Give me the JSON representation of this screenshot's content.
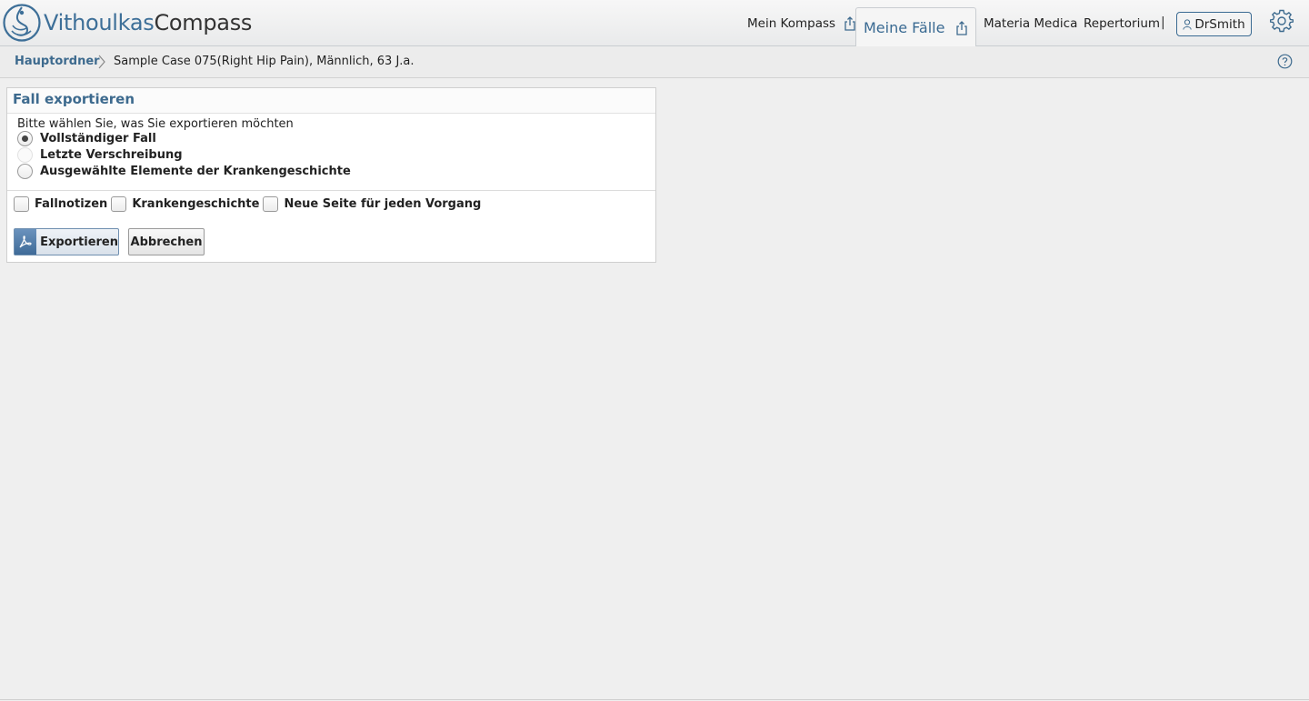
{
  "app": {
    "logo_part1": "Vithoulkas",
    "logo_part2": "Compass"
  },
  "nav": {
    "mein_kompass": "Mein Kompass",
    "meine_faelle": "Meine Fälle",
    "materia_medica": "Materia Medica",
    "repertorium": "Repertorium",
    "separator": "|",
    "user": "DrSmith"
  },
  "breadcrumb": {
    "home": "Hauptordner",
    "case": "Sample Case 075(Right Hip Pain), Männlich, 63 J.a."
  },
  "dialog": {
    "title": "Fall exportieren",
    "prompt": "Bitte wählen Sie, was Sie exportieren möchten",
    "options": [
      {
        "label": "Vollständiger Fall",
        "selected": true,
        "enabled": true
      },
      {
        "label": "Letzte Verschreibung",
        "selected": false,
        "enabled": false
      },
      {
        "label": "Ausgewählte Elemente der Krankengeschichte",
        "selected": false,
        "enabled": true
      }
    ],
    "checkboxes": [
      {
        "label": "Fallnotizen",
        "checked": false
      },
      {
        "label": "Krankengeschichte",
        "checked": false
      },
      {
        "label": "Neue Seite für jeden Vorgang",
        "checked": false
      }
    ],
    "export_label": "Exportieren",
    "cancel_label": "Abbrechen"
  },
  "colors": {
    "accent": "#3d6a8e",
    "active_tab_text": "#3a6a92"
  }
}
